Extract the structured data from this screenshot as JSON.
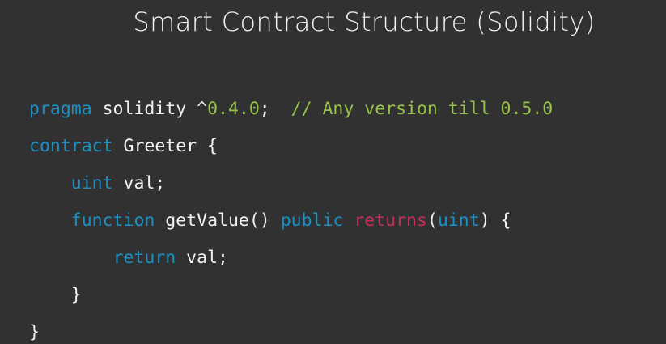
{
  "slide": {
    "title": "Smart Contract Structure (Solidity)"
  },
  "code": {
    "line1": {
      "kw_pragma": "pragma",
      "t1": " solidity ^",
      "version": "0.4.0",
      "t2": ";  ",
      "comment": "// Any version till 0.5.0"
    },
    "line2": {
      "kw_contract": "contract",
      "t1": " Greeter {"
    },
    "line3": {
      "indent": "    ",
      "kw_uint": "uint",
      "t1": " val;"
    },
    "line4": {
      "indent": "    ",
      "kw_function": "function",
      "t1": " getValue() ",
      "kw_public": "public",
      "t2": " ",
      "kw_returns": "returns",
      "t3": "(",
      "kw_uint": "uint",
      "t4": ") {"
    },
    "line5": {
      "indent": "        ",
      "kw_return": "return",
      "t1": " val;"
    },
    "line6": {
      "indent": "    ",
      "t1": "}"
    },
    "line7": {
      "t1": "}"
    }
  },
  "colors": {
    "background": "#313131",
    "text": "#f2f2f2",
    "keyword": "#1e8fc1",
    "number_comment": "#97c24b",
    "returns_keyword": "#c2305a"
  }
}
